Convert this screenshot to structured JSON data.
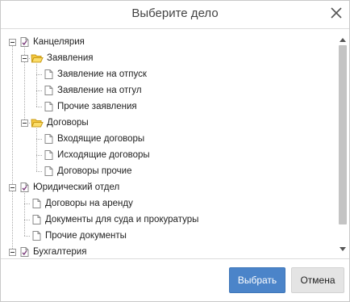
{
  "dialog": {
    "title": "Выберите дело",
    "close_icon": "close-icon"
  },
  "tree": {
    "items": [
      {
        "label": "Канцелярия",
        "icon": "folder-doc-icon",
        "level": 0,
        "expanded": true
      },
      {
        "label": "Заявления",
        "icon": "folder-open-icon",
        "level": 1,
        "expanded": true
      },
      {
        "label": "Заявление на отпуск",
        "icon": "document-icon",
        "level": 2
      },
      {
        "label": "Заявление на отгул",
        "icon": "document-icon",
        "level": 2
      },
      {
        "label": "Прочие заявления",
        "icon": "document-icon",
        "level": 2
      },
      {
        "label": "Договоры",
        "icon": "folder-open-icon",
        "level": 1,
        "expanded": true
      },
      {
        "label": "Входящие договоры",
        "icon": "document-icon",
        "level": 2
      },
      {
        "label": "Исходящие договоры",
        "icon": "document-icon",
        "level": 2
      },
      {
        "label": "Договоры прочие",
        "icon": "document-icon",
        "level": 2
      },
      {
        "label": "Юридический отдел",
        "icon": "folder-doc-icon",
        "level": 0,
        "expanded": true
      },
      {
        "label": "Договоры на аренду",
        "icon": "document-icon",
        "level": 1
      },
      {
        "label": "Документы для суда и прокуратуры",
        "icon": "document-icon",
        "level": 1
      },
      {
        "label": "Прочие документы",
        "icon": "document-icon",
        "level": 1
      },
      {
        "label": "Бухгалтерия",
        "icon": "folder-doc-icon",
        "level": 0,
        "expanded": true
      }
    ]
  },
  "footer": {
    "select_label": "Выбрать",
    "cancel_label": "Отмена"
  },
  "colors": {
    "primary_button": "#4b84c9",
    "secondary_button": "#e4e4e4",
    "folder": "#f5c842",
    "node_icon": "#7a3b7a"
  }
}
